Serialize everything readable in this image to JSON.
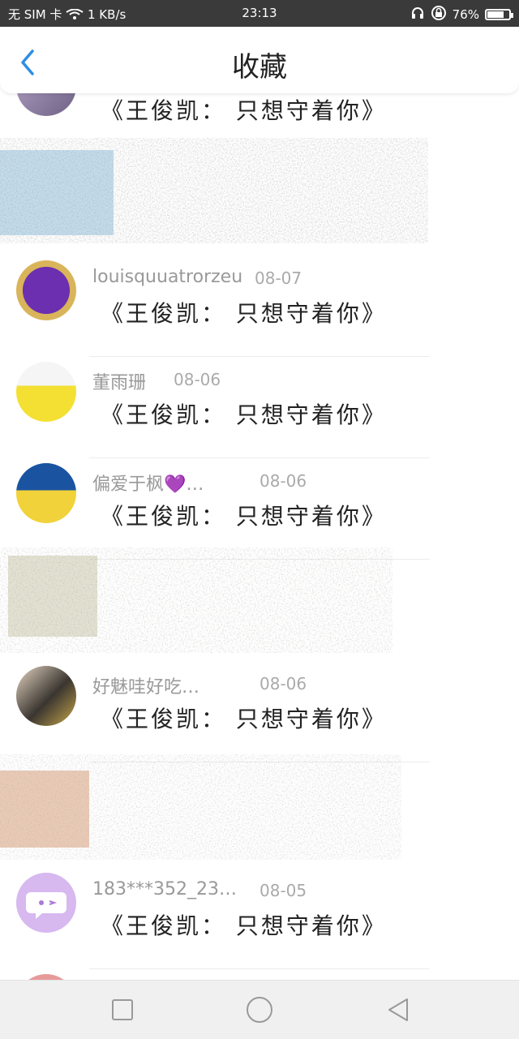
{
  "status_bar": {
    "carrier": "无 SIM 卡",
    "speed": "1 KB/s",
    "time": "23:13",
    "battery": "76%",
    "battery_level": 0.76
  },
  "header": {
    "title": "收藏"
  },
  "message_text": "《王俊凯： 只想守着你》",
  "rows": [
    {
      "name": "",
      "date": "",
      "msg": "《王俊凯： 只想守着你》"
    },
    {
      "name": "louisquuatrorzeu",
      "date": "08-07",
      "msg": "《王俊凯： 只想守着你》"
    },
    {
      "name": "董雨珊",
      "date": "08-06",
      "msg": "《王俊凯： 只想守着你》"
    },
    {
      "name": "偏爱于枫💜…",
      "date": "08-06",
      "msg": "《王俊凯： 只想守着你》"
    },
    {
      "name": "好魅哇好吃…",
      "date": "08-06",
      "msg": "《王俊凯： 只想守着你》"
    },
    {
      "name": "183***352_23…",
      "date": "08-05",
      "msg": "《王俊凯： 只想守着你》"
    }
  ],
  "colors": {
    "accent": "#2f8de4",
    "status_bg": "#3a3a3a"
  }
}
